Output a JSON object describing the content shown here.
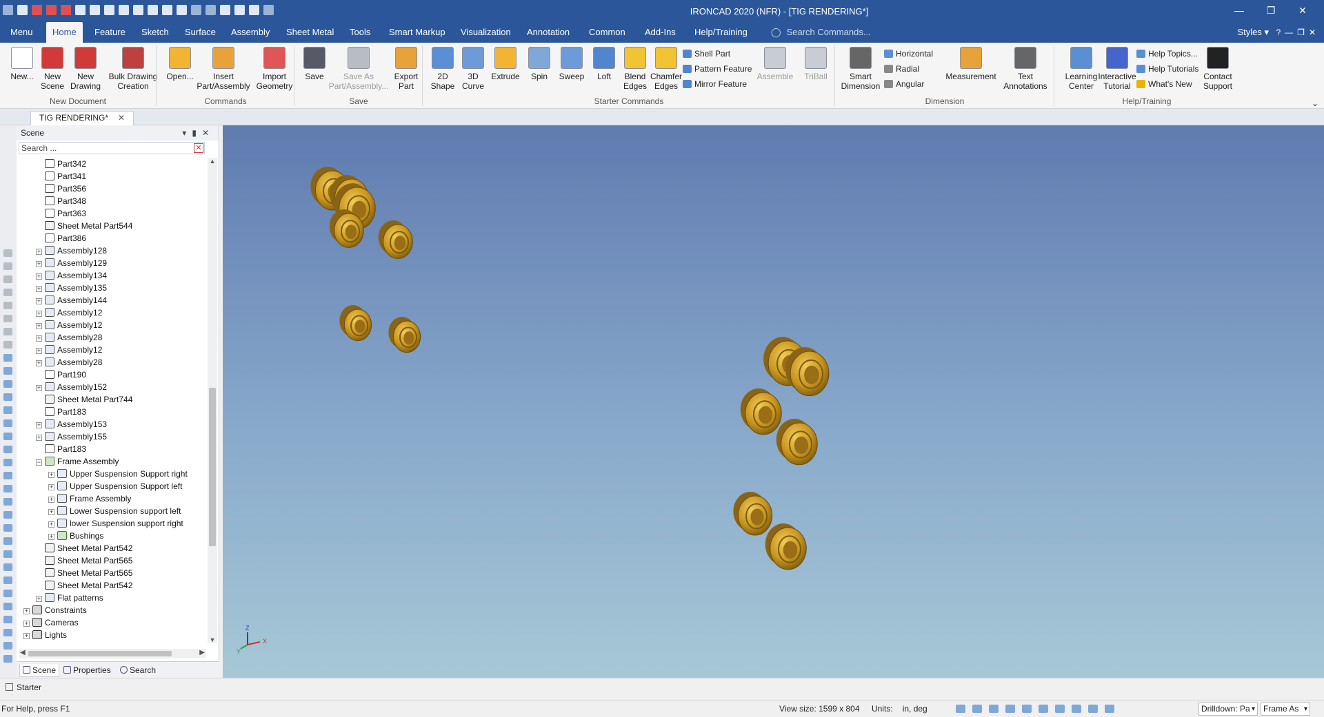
{
  "app": {
    "title": "IRONCAD 2020 (NFR) - [TIG RENDERING*]"
  },
  "menu_tabs": [
    {
      "label": "Menu"
    },
    {
      "label": "Home"
    },
    {
      "label": "Feature"
    },
    {
      "label": "Sketch"
    },
    {
      "label": "Surface"
    },
    {
      "label": "Assembly"
    },
    {
      "label": "Sheet Metal"
    },
    {
      "label": "Tools"
    },
    {
      "label": "Smart Markup"
    },
    {
      "label": "Visualization"
    },
    {
      "label": "Annotation"
    },
    {
      "label": "Common"
    },
    {
      "label": "Add-Ins"
    },
    {
      "label": "Help/Training"
    }
  ],
  "active_tab": "Home",
  "search_commands_placeholder": "Search Commands...",
  "styles_label": "Styles",
  "ribbon": {
    "groups": [
      "New Document",
      "Commands",
      "Save",
      "Starter Commands",
      "Dimension",
      "Help/Training"
    ],
    "buttons": [
      {
        "l1": "New...",
        "l2": "",
        "icon": "new-document-icon",
        "color": "#ffffff"
      },
      {
        "l1": "New",
        "l2": "Scene",
        "icon": "new-scene-icon",
        "color": "#d23a3a"
      },
      {
        "l1": "New",
        "l2": "Drawing",
        "icon": "new-drawing-icon",
        "color": "#d23a3a"
      },
      {
        "l1": "Bulk Drawing",
        "l2": "Creation",
        "icon": "bulk-drawing-icon",
        "color": "#c04040"
      },
      {
        "l1": "Open...",
        "l2": "",
        "icon": "open-folder-icon",
        "color": "#f2b431"
      },
      {
        "l1": "Insert",
        "l2": "Part/Assembly",
        "icon": "insert-part-icon",
        "color": "#e8a23a"
      },
      {
        "l1": "Import",
        "l2": "Geometry",
        "icon": "import-geometry-icon",
        "color": "#e05555"
      },
      {
        "l1": "Save",
        "l2": "",
        "icon": "save-icon",
        "color": "#555a66"
      },
      {
        "l1": "Save As",
        "l2": "Part/Assembly...",
        "icon": "save-as-icon",
        "color": "#b8bcc4"
      },
      {
        "l1": "Export",
        "l2": "Part",
        "icon": "export-part-icon",
        "color": "#e8a23a"
      },
      {
        "l1": "2D",
        "l2": "Shape",
        "icon": "2d-shape-icon",
        "color": "#5a8fd6"
      },
      {
        "l1": "3D",
        "l2": "Curve",
        "icon": "3d-curve-icon",
        "color": "#6d9bd9"
      },
      {
        "l1": "Extrude",
        "l2": "",
        "icon": "extrude-icon",
        "color": "#f2b431"
      },
      {
        "l1": "Spin",
        "l2": "",
        "icon": "spin-icon",
        "color": "#7fa8d9"
      },
      {
        "l1": "Sweep",
        "l2": "",
        "icon": "sweep-icon",
        "color": "#6d9bd9"
      },
      {
        "l1": "Loft",
        "l2": "",
        "icon": "loft-icon",
        "color": "#4f86cf"
      },
      {
        "l1": "Blend",
        "l2": "Edges",
        "icon": "blend-edges-icon",
        "color": "#f2c431"
      },
      {
        "l1": "Chamfer",
        "l2": "Edges",
        "icon": "chamfer-edges-icon",
        "color": "#f2c431"
      },
      {
        "l1": "Assemble",
        "l2": "",
        "icon": "assemble-icon",
        "color": "#c8ccd4"
      },
      {
        "l1": "TriBall",
        "l2": "",
        "icon": "triball-icon",
        "color": "#c8ccd4"
      },
      {
        "l1": "Smart",
        "l2": "Dimension",
        "icon": "smart-dimension-icon",
        "color": "#666666"
      },
      {
        "l1": "Measurement",
        "l2": "",
        "icon": "measurement-icon",
        "color": "#e8a23a"
      },
      {
        "l1": "Text",
        "l2": "Annotations",
        "icon": "text-annotation-icon",
        "color": "#666666"
      },
      {
        "l1": "Learning",
        "l2": "Center",
        "icon": "learning-center-icon",
        "color": "#5a8fd6"
      },
      {
        "l1": "Interactive",
        "l2": "Tutorial",
        "icon": "interactive-tutorial-icon",
        "color": "#4466cc"
      },
      {
        "l1": "Contact",
        "l2": "Support",
        "icon": "contact-support-icon",
        "color": "#222222"
      }
    ],
    "small_buttons": {
      "shell_part": "Shell Part",
      "pattern_feature": "Pattern Feature",
      "mirror_feature": "Mirror Feature",
      "horizontal": "Horizontal",
      "radial": "Radial",
      "angular": "Angular",
      "help_topics": "Help Topics...",
      "help_tutorials": "Help Tutorials",
      "whats_new": "What's New"
    }
  },
  "document_tab": {
    "label": "TIG RENDERING*"
  },
  "scene_panel": {
    "title": "Scene",
    "search_placeholder": "Search ...",
    "tree": [
      {
        "label": "Part342",
        "depth": 1,
        "expand": false,
        "icon": "part"
      },
      {
        "label": "Part341",
        "depth": 1,
        "expand": false,
        "icon": "part"
      },
      {
        "label": "Part356",
        "depth": 1,
        "expand": false,
        "icon": "part"
      },
      {
        "label": "Part348",
        "depth": 1,
        "expand": false,
        "icon": "part"
      },
      {
        "label": "Part363",
        "depth": 1,
        "expand": false,
        "icon": "part"
      },
      {
        "label": "Sheet Metal Part544",
        "depth": 1,
        "expand": false,
        "icon": "sheetmetal"
      },
      {
        "label": "Part386",
        "depth": 1,
        "expand": false,
        "icon": "part"
      },
      {
        "label": "Assembly128",
        "depth": 1,
        "expand": true,
        "icon": "assembly"
      },
      {
        "label": "Assembly129",
        "depth": 1,
        "expand": true,
        "icon": "assembly"
      },
      {
        "label": "Assembly134",
        "depth": 1,
        "expand": true,
        "icon": "assembly"
      },
      {
        "label": "Assembly135",
        "depth": 1,
        "expand": true,
        "icon": "assembly"
      },
      {
        "label": "Assembly144",
        "depth": 1,
        "expand": true,
        "icon": "assembly"
      },
      {
        "label": "Assembly12",
        "depth": 1,
        "expand": true,
        "icon": "assembly"
      },
      {
        "label": "Assembly12",
        "depth": 1,
        "expand": true,
        "icon": "assembly"
      },
      {
        "label": "Assembly28",
        "depth": 1,
        "expand": true,
        "icon": "assembly"
      },
      {
        "label": "Assembly12",
        "depth": 1,
        "expand": true,
        "icon": "assembly"
      },
      {
        "label": "Assembly28",
        "depth": 1,
        "expand": true,
        "icon": "assembly"
      },
      {
        "label": "Part190",
        "depth": 1,
        "expand": false,
        "icon": "part"
      },
      {
        "label": "Assembly152",
        "depth": 1,
        "expand": true,
        "icon": "assembly"
      },
      {
        "label": "Sheet Metal Part744",
        "depth": 1,
        "expand": false,
        "icon": "sheetmetal"
      },
      {
        "label": "Part183",
        "depth": 1,
        "expand": false,
        "icon": "part"
      },
      {
        "label": "Assembly153",
        "depth": 1,
        "expand": true,
        "icon": "assembly"
      },
      {
        "label": "Assembly155",
        "depth": 1,
        "expand": true,
        "icon": "assembly"
      },
      {
        "label": "Part183",
        "depth": 1,
        "expand": false,
        "icon": "part"
      },
      {
        "label": "Frame Assembly",
        "depth": 1,
        "expand": true,
        "expanded": true,
        "icon": "frame"
      },
      {
        "label": "Upper Suspension Support right",
        "depth": 2,
        "expand": true,
        "icon": "assembly"
      },
      {
        "label": "Upper Suspension Support left",
        "depth": 2,
        "expand": true,
        "icon": "assembly"
      },
      {
        "label": "Frame Assembly",
        "depth": 2,
        "expand": true,
        "icon": "assembly"
      },
      {
        "label": "Lower Suspension support left",
        "depth": 2,
        "expand": true,
        "icon": "assembly"
      },
      {
        "label": "lower Suspension support right",
        "depth": 2,
        "expand": true,
        "icon": "assembly"
      },
      {
        "label": "Bushings",
        "depth": 2,
        "expand": true,
        "icon": "frame"
      },
      {
        "label": "Sheet Metal Part542",
        "depth": 1,
        "expand": false,
        "icon": "sheetmetal"
      },
      {
        "label": "Sheet Metal Part565",
        "depth": 1,
        "expand": false,
        "icon": "sheetmetal"
      },
      {
        "label": "Sheet Metal Part565",
        "depth": 1,
        "expand": false,
        "icon": "sheetmetal"
      },
      {
        "label": "Sheet Metal Part542",
        "depth": 1,
        "expand": false,
        "icon": "sheetmetal"
      },
      {
        "label": "Flat patterns",
        "depth": 1,
        "expand": true,
        "icon": "assembly"
      },
      {
        "label": "Constraints",
        "depth": 0,
        "expand": true,
        "icon": "system"
      },
      {
        "label": "Cameras",
        "depth": 0,
        "expand": true,
        "icon": "system"
      },
      {
        "label": "Lights",
        "depth": 0,
        "expand": true,
        "icon": "system"
      }
    ],
    "bottom_tabs": [
      {
        "label": "Scene"
      },
      {
        "label": "Properties"
      },
      {
        "label": "Search"
      }
    ]
  },
  "viewport": {
    "bg_top": "#5f7bb0",
    "bg_bottom": "#a6c8d6",
    "part_color": "#c8951e",
    "axis_labels": {
      "x": "X",
      "y": "Y",
      "z": "Z"
    }
  },
  "starter_label": "Starter",
  "status": {
    "help": "For Help, press F1",
    "view_size": "View size: 1599 x  804",
    "units_label": "Units:",
    "units_value": "in, deg",
    "drilldown": "Drilldown: Pa",
    "frame": "Frame As"
  }
}
